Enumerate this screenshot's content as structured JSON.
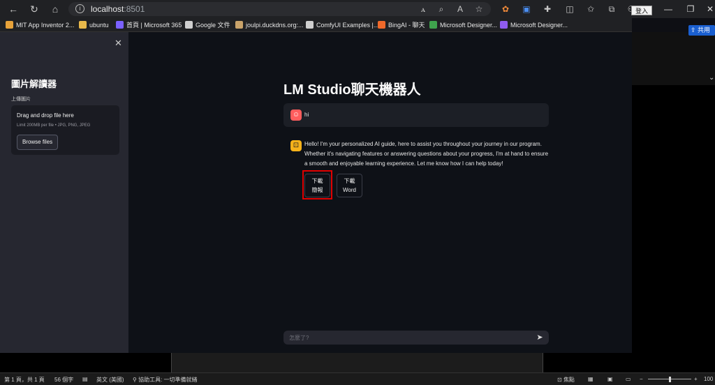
{
  "browser": {
    "url_host": "localhost",
    "url_port": ":8501",
    "login_label": "登入",
    "share_label": "共用"
  },
  "bookmarks": [
    {
      "label": "MIT App Inventor 2...",
      "color": "#e8a33a"
    },
    {
      "label": "ubuntu",
      "color": "#e8b84a"
    },
    {
      "label": "首頁 | Microsoft 365",
      "color": "#7b61ff"
    },
    {
      "label": "Google 文件",
      "color": "#cfcfcf"
    },
    {
      "label": "joulpi.duckdns.org:...",
      "color": "#c9a36a"
    },
    {
      "label": "ComfyUI Examples |...",
      "color": "#cfcfcf"
    },
    {
      "label": "BingAI - 聊天",
      "color": "#f0692a"
    },
    {
      "label": "Microsoft Designer...",
      "color": "#3fa34d"
    },
    {
      "label": "Microsoft Designer...",
      "color": "#8f5cf0"
    }
  ],
  "sidebar": {
    "title": "圖片解讀器",
    "upload_label": "上傳圖片",
    "drop_title": "Drag and drop file here",
    "drop_limit": "Limit 200MB per file • JPG, PNG, JPEG",
    "browse_label": "Browse files"
  },
  "main": {
    "heading": "LM Studio聊天機器人",
    "user_message": "hi",
    "bot_message": "Hello! I'm your personalized AI guide, here to assist you throughout your journey in our program. Whether it's navigating features or answering questions about your progress, I'm at hand to ensure a smooth and enjoyable learning experience. Let me know how I can help today!",
    "download_brief_line1": "下載",
    "download_brief_line2": "簡報",
    "download_word_line1": "下載",
    "download_word_line2": "Word",
    "input_placeholder": "怎麼了?"
  },
  "statusbar": {
    "page": "第 1 頁，共 1 頁",
    "words": "56 個字",
    "language": "英文 (美國)",
    "accessibility": "協助工具: 一切準備就緒",
    "focus": "焦點",
    "zoom": "100"
  },
  "colors": {
    "accent_red": "#e00000",
    "user_avatar": "#ff5d5d",
    "bot_avatar": "#f7b21a"
  }
}
